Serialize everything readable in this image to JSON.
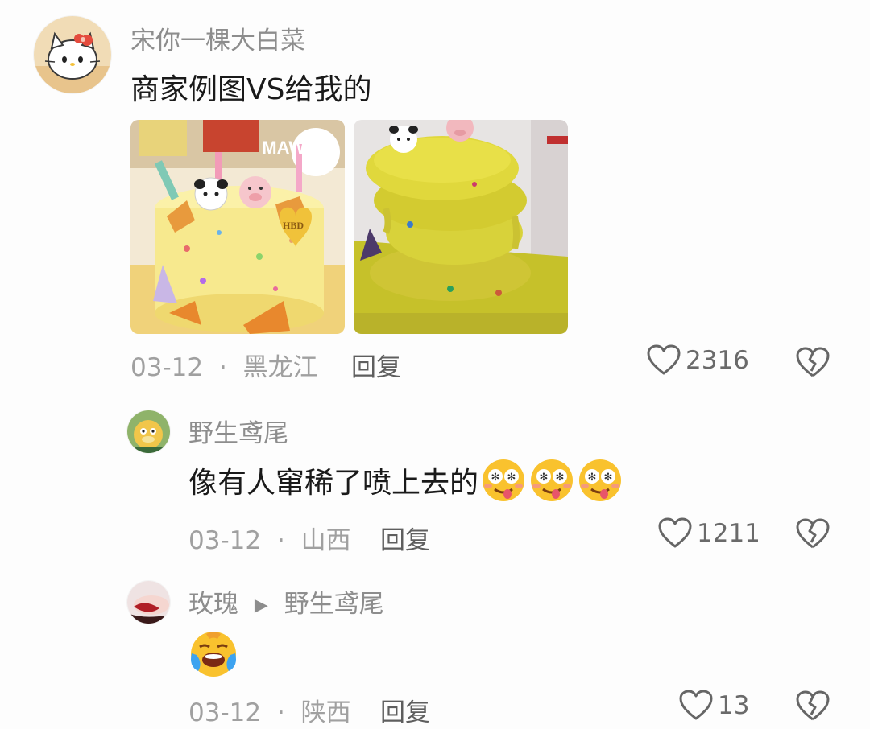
{
  "comments": [
    {
      "username": "宋你一棵大白菜",
      "text": "商家例图VS给我的",
      "image_overlay_text": "MAW★",
      "cake_topper_text": "HBD",
      "date": "03-12",
      "separator": "·",
      "location": "黑龙江",
      "reply_label": "回复",
      "likes": "2316"
    },
    {
      "username": "野生鸢尾",
      "text": "像有人窜稀了喷上去的",
      "emoji_count": 3,
      "emoji_name": "drooling-face-emoji",
      "date": "03-12",
      "separator": "·",
      "location": "山西",
      "reply_label": "回复",
      "likes": "1211"
    },
    {
      "username": "玫瑰",
      "reply_to": "野生鸢尾",
      "reply_arrow_icon": "right-triangle-icon",
      "emoji_name": "laughing-face-emoji",
      "date": "03-12",
      "separator": "·",
      "location": "陕西",
      "reply_label": "回复",
      "likes": "13"
    }
  ],
  "colors": {
    "background": "#fdfdfd",
    "username": "#8d8d8d",
    "meta": "#a0a0a0",
    "text": "#1a1a1a"
  }
}
